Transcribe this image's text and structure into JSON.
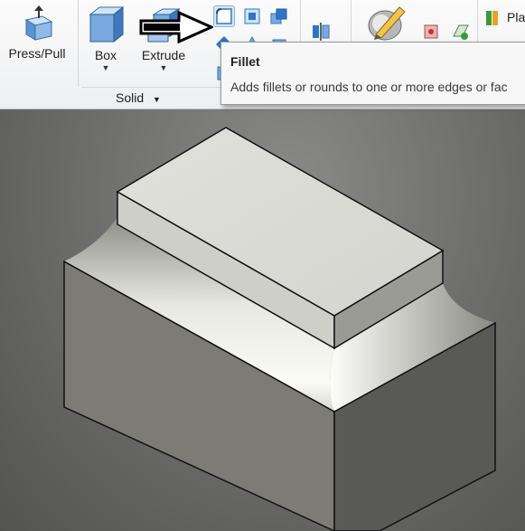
{
  "ribbon": {
    "press_pull_label": "Press/Pull",
    "box_label": "Box",
    "extrude_label": "Extrude",
    "group_label": "Solid",
    "plane_label": "Pla"
  },
  "tooltip": {
    "title": "Fillet",
    "description": "Adds fillets or rounds to one or more edges or fac"
  },
  "colors": {
    "ribbon_bg": "#f3f4f6",
    "selected_tool": "#2e75c9",
    "viewport_bg": "#6d6d6b",
    "model_face": "#d9d9d5"
  }
}
